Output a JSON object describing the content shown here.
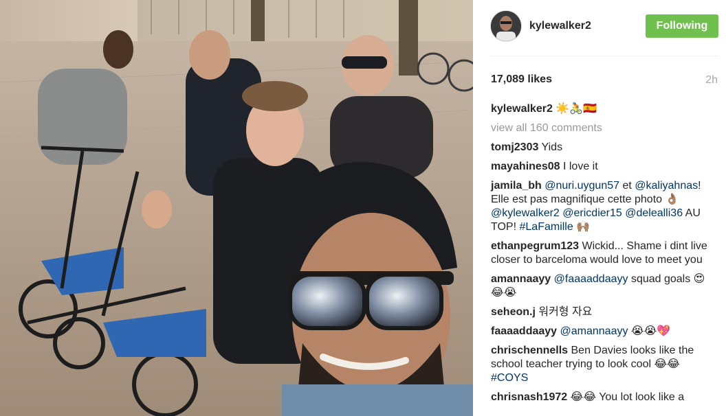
{
  "post": {
    "username": "kylewalker2",
    "follow_label": "Following",
    "likes": "17,089 likes",
    "time": "2h",
    "caption_emoji": "☀️🚴🇪🇸",
    "view_all": "view all 160 comments"
  },
  "comments": [
    {
      "user": "tomj2303",
      "text": "Yids"
    },
    {
      "user": "mayahines08",
      "text": "I love it"
    },
    {
      "user": "jamila_bh",
      "parts": [
        {
          "t": "m",
          "v": "@nuri.uygun57"
        },
        {
          "t": "t",
          "v": " et "
        },
        {
          "t": "m",
          "v": "@kaliyahnas"
        },
        {
          "t": "t",
          "v": "! Elle est pas magnifique cette photo 👌🏽 "
        },
        {
          "t": "m",
          "v": "@kylewalker2"
        },
        {
          "t": "t",
          "v": " "
        },
        {
          "t": "m",
          "v": "@ericdier15"
        },
        {
          "t": "t",
          "v": " "
        },
        {
          "t": "m",
          "v": "@delealli36"
        },
        {
          "t": "t",
          "v": " AU TOP! "
        },
        {
          "t": "m",
          "v": "#LaFamille"
        },
        {
          "t": "t",
          "v": " 🙌🏽"
        }
      ]
    },
    {
      "user": "ethanpegrum123",
      "text": "Wickid... Shame i dint live closer to barceloma would love to meet you"
    },
    {
      "user": "amannaayy",
      "parts": [
        {
          "t": "m",
          "v": "@faaaaddaayy"
        },
        {
          "t": "t",
          "v": " squad goals 😍😂😭"
        }
      ]
    },
    {
      "user": "seheon.j",
      "text": "워커형 자요"
    },
    {
      "user": "faaaaddaayy",
      "parts": [
        {
          "t": "m",
          "v": "@amannaayy"
        },
        {
          "t": "t",
          "v": " 😭😭💖"
        }
      ]
    },
    {
      "user": "chrischennells",
      "parts": [
        {
          "t": "t",
          "v": "Ben Davies looks like the school teacher trying to look cool 😂😂 "
        },
        {
          "t": "m",
          "v": "#COYS"
        }
      ]
    },
    {
      "user": "chrisnash1972",
      "text": "😂😂 You lot look like a"
    }
  ]
}
